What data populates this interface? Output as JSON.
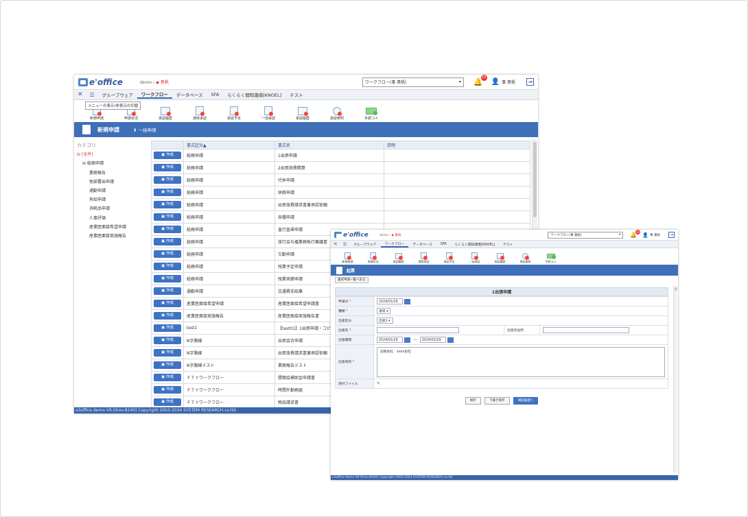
{
  "main": {
    "logo": "e'office",
    "breadcrumb": {
      "system": "demo",
      "sep": "›",
      "user": "◆ 貴帆"
    },
    "workflow_select": "ワークフロー(事 貴帆)",
    "notif_count": "15",
    "user_name": "事 貴帆",
    "tabs": [
      "グループウェア",
      "ワークフロー",
      "データベース",
      "SFA",
      "らくらく間知識借[KNOEL]",
      "テスト"
    ],
    "tooltip": "メニューの表示/非表示の切替",
    "tools": [
      "新規申請",
      "申請状況",
      "承認履歴",
      "通常承認",
      "承認予定",
      "一括承認",
      "承認履歴",
      "承認参照",
      "手続コメ"
    ],
    "bar_title": "新規申請",
    "bulk_label": "一括申請",
    "category_header": "カテゴリ",
    "categories": {
      "root": "[全件]",
      "group": "総務申請",
      "items": [
        "業務報告",
        "他部署出申請",
        "通勤申請",
        "有給申請",
        "消耗品申請",
        "人事評価",
        "産業医面接希望申請",
        "産業医面接実施報告"
      ]
    },
    "columns": [
      "書式区分▲",
      "書式名",
      "説明"
    ],
    "create_label": "作成",
    "rows": [
      {
        "kubun": "総務申請",
        "name": "1出張申請"
      },
      {
        "kubun": "総務申請",
        "name": "2出張旅費精算"
      },
      {
        "kubun": "総務申請",
        "name": "代休申請"
      },
      {
        "kubun": "総務申請",
        "name": "休暇申請"
      },
      {
        "kubun": "総務申請",
        "name": "出張旅費請求書兼承認依頼"
      },
      {
        "kubun": "総務申請",
        "name": "各種申請"
      },
      {
        "kubun": "総務申請",
        "name": "直行直帰申請"
      },
      {
        "kubun": "総務申請",
        "name": "旅行会与播業務執行稟議書"
      },
      {
        "kubun": "総務申請",
        "name": "欠勤申請"
      },
      {
        "kubun": "総務申請",
        "name": "残業予定申請"
      },
      {
        "kubun": "総務申請",
        "name": "残業実績申請"
      },
      {
        "kubun": "通勤申請",
        "name": "交通費支給稟"
      },
      {
        "kubun": "産業医面接希望申請",
        "name": "産業医面接希望申請書"
      },
      {
        "kubun": "産業医面接実施報告",
        "name": "産業医面接実施報告書"
      },
      {
        "kubun": "test1",
        "name": "【test01】1出張申請・コピ"
      },
      {
        "kubun": "N字路線",
        "name": "出張会合申請"
      },
      {
        "kubun": "N字路線",
        "name": "出張旅費請求書兼承認依頼"
      },
      {
        "kubun": "N字路線テスト",
        "name": "業務報告テスト"
      },
      {
        "kubun": "ＦＴＹワークフロー",
        "name": "懇親会補助金申請書"
      },
      {
        "kubun": "ＦＴＹワークフロー",
        "name": "時間外勤務届"
      },
      {
        "kubun": "ＦＴＹワークフロー",
        "name": "物品請求書"
      }
    ],
    "footer": "e3office demo V9.0[rev.8240] Copyright 2003-2024 SYSTEM RESEARCH co.ltd"
  },
  "sub": {
    "logo": "e'office",
    "breadcrumb": {
      "system": "demo",
      "sep": "›",
      "user": "◆ 貴帆"
    },
    "workflow_select": "ワークフロー(事 貴帆)",
    "notif_count": "15",
    "user_name": "事 貴帆",
    "tabs": [
      "グループウェア",
      "ワークフロー",
      "データベース",
      "SFA",
      "らくらく間知識借[KNOEL]",
      "テスト"
    ],
    "tools": [
      "新規申請",
      "申請状況",
      "承認履歴",
      "通常承認",
      "承認予定",
      "一括承認",
      "承認履歴",
      "承認参照",
      "手続コメ"
    ],
    "bar_title": "起票",
    "back_label": "書式申請一覧へ戻る",
    "form_title": "1出張申請",
    "fields": {
      "date_label": "申請日",
      "date_value": "2024/01/29",
      "type_label": "種類",
      "type_value": "通常",
      "area_label": "出張区分",
      "area_value": "出張1",
      "dest_label": "出張先",
      "dest2_label": "出張先住所",
      "period_label": "出張期間",
      "period_from": "2024/01/29",
      "period_sep": "〜",
      "period_to": "2024/01/29",
      "purpose_label": "出張目的",
      "purpose_value": "訪問会社　xxxx会社",
      "attach_label": "添付ファイル"
    },
    "buttons": [
      "保存",
      "下書き保存",
      "確認画面へ"
    ],
    "footer": "e3office demo V9.0[rev.8240] Copyright 2003-2024 SYSTEM RESEARCH co.ltd"
  }
}
